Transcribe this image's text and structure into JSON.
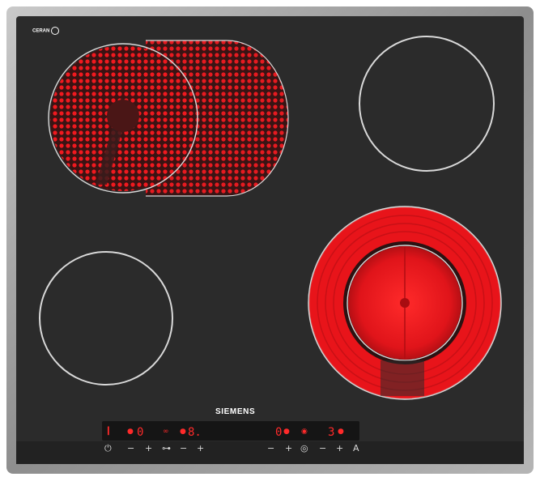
{
  "brand": {
    "name": "SIEMENS",
    "logo_text": "CERAN"
  },
  "colors": {
    "glass": "#2b2b2b",
    "frame": "#9a9a9a",
    "heat": "#e8141a",
    "display": "#ff2a2a",
    "ring": "#d9d9d9"
  },
  "zones": [
    {
      "id": "front-left-extended",
      "state": "on"
    },
    {
      "id": "back-right",
      "state": "off"
    },
    {
      "id": "front-left",
      "state": "off"
    },
    {
      "id": "front-right-dual",
      "state": "on"
    }
  ],
  "controls": {
    "power_icon": "power-icon",
    "minus": "−",
    "plus": "+",
    "display_1": "0",
    "display_2": "8.",
    "display_3": "0",
    "display_4": "3",
    "timer_label": "A"
  }
}
